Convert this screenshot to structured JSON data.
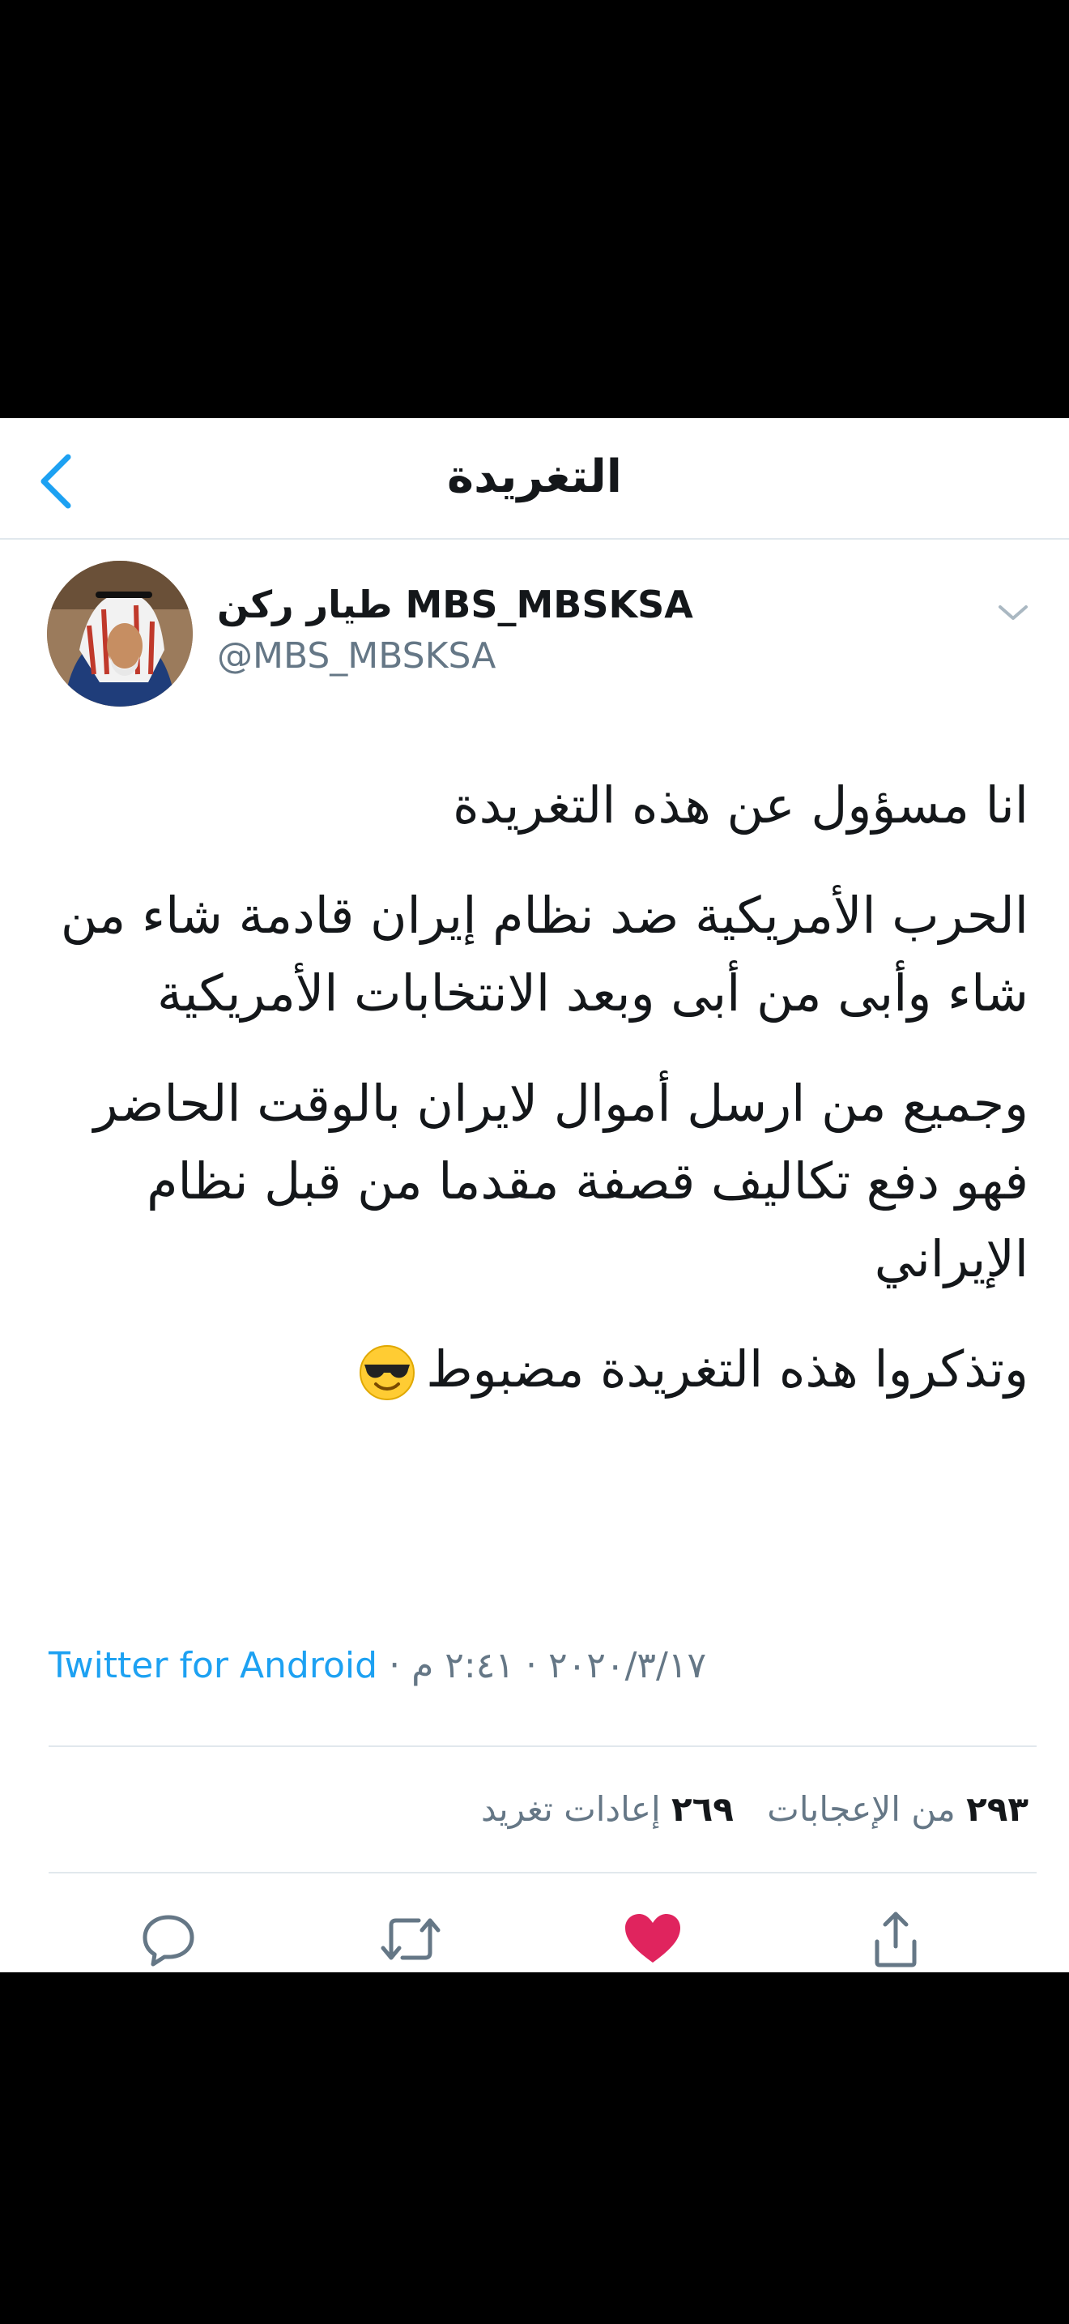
{
  "header": {
    "title": "التغريدة",
    "back_icon": "chevron-left-icon"
  },
  "tweet": {
    "display_name": "طيار ركن MBS_MBSKSA",
    "handle": "@MBS_MBSKSA",
    "paragraphs": [
      "انا مسؤول عن هذه التغريدة",
      "الحرب الأمريكية ضد نظام إيران قادمة شاء من شاء وأبى من أبى وبعد الانتخابات الأمريكية",
      "وجميع من ارسل أموال لايران بالوقت الحاضر فهو دفع تكاليف قصفة مقدما من قبل نظام الإيراني",
      "وتذكروا هذه التغريدة مضبوط"
    ],
    "emoji": "smiling-face-with-sunglasses",
    "time": "٢:٤١ م",
    "date": "٢٠٢٠/٣/١٧",
    "separator": "·",
    "source": "Twitter for Android",
    "retweets_count": "٢٦٩",
    "retweets_label": "إعادات تغريد",
    "likes_count": "٢٩٣",
    "likes_label": "من الإعجابات"
  },
  "actions": {
    "reply_icon": "reply-icon",
    "retweet_icon": "retweet-icon",
    "like_icon": "heart-icon",
    "share_icon": "share-icon"
  },
  "colors": {
    "accent": "#1da1f2",
    "like": "#e0245e",
    "text": "#14171a",
    "muted": "#657786",
    "divider": "#e1e8ed"
  }
}
